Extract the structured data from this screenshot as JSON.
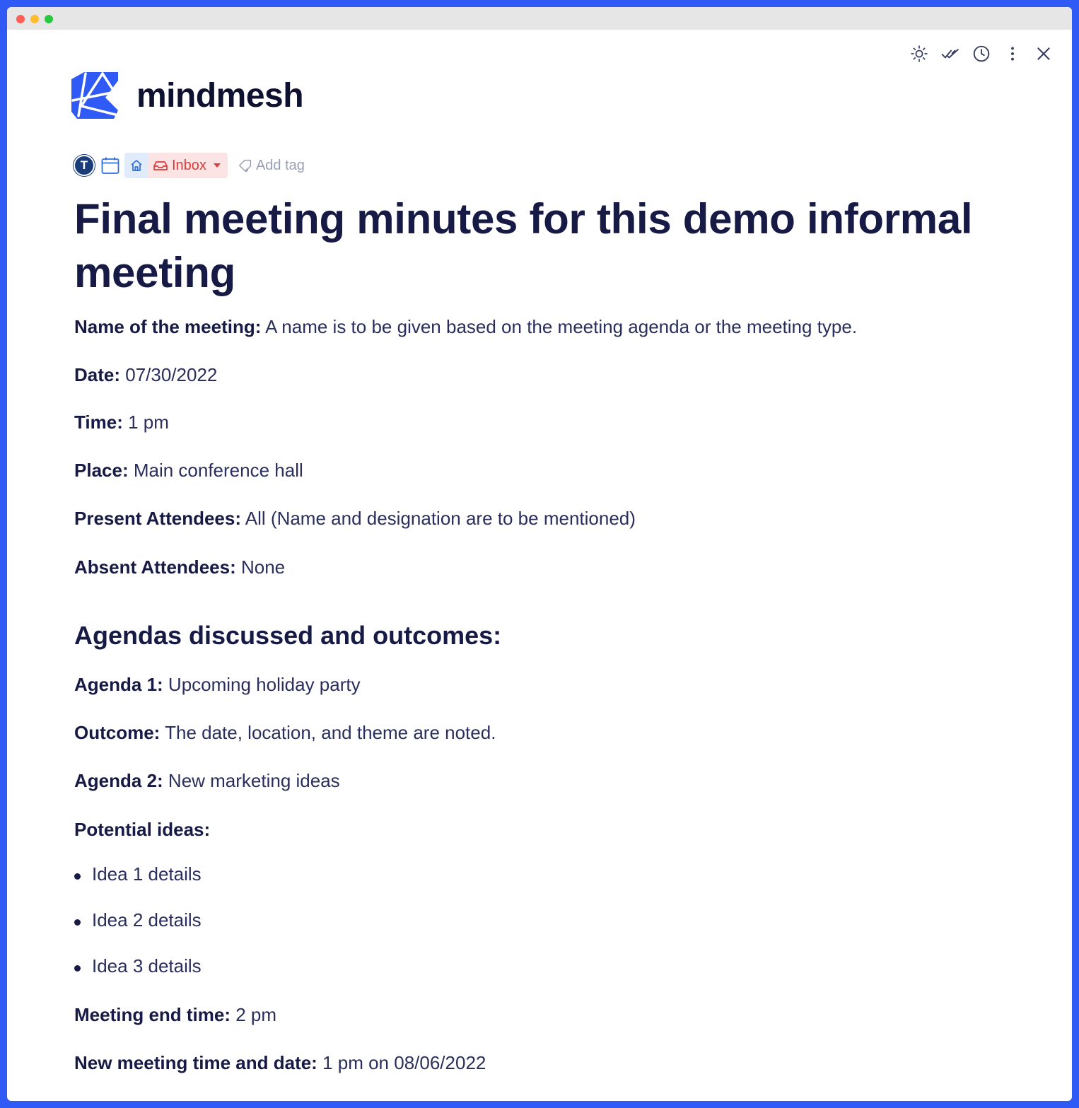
{
  "app": {
    "logo_text": "mindmesh",
    "brand_color": "#2f5af5",
    "accent_red": "#d93a3a"
  },
  "toolbar": {
    "icons": [
      "sun-icon",
      "double-check-icon",
      "clock-icon",
      "more-vertical-icon",
      "close-icon"
    ]
  },
  "meta": {
    "avatar_initial": "T",
    "location_label": "Inbox",
    "add_tag_label": "Add tag"
  },
  "document": {
    "title": "Final meeting minutes for this demo informal meeting",
    "fields": [
      {
        "label": "Name of the meeting:",
        "value": " A name is to be given based on the meeting agenda or the meeting type."
      },
      {
        "label": "Date:",
        "value": " 07/30/2022"
      },
      {
        "label": "Time:",
        "value": " 1 pm"
      },
      {
        "label": "Place:",
        "value": " Main conference hall"
      },
      {
        "label": "Present Attendees:",
        "value": " All (Name and designation are to be mentioned)"
      },
      {
        "label": "Absent Attendees:",
        "value": " None"
      }
    ],
    "section_heading": "Agendas discussed and outcomes:",
    "agenda": [
      {
        "label": "Agenda 1:",
        "value": " Upcoming holiday party"
      },
      {
        "label": "Outcome:",
        "value": " The date, location, and theme are noted."
      },
      {
        "label": "Agenda 2:",
        "value": " New marketing ideas"
      },
      {
        "label": "Potential ideas:",
        "value": ""
      }
    ],
    "ideas": [
      "Idea 1 details",
      "Idea 2 details",
      "Idea 3 details"
    ],
    "closing": [
      {
        "label": "Meeting end time:",
        "value": " 2 pm"
      },
      {
        "label": "New meeting time and date:",
        "value": " 1 pm on 08/06/2022"
      }
    ]
  }
}
